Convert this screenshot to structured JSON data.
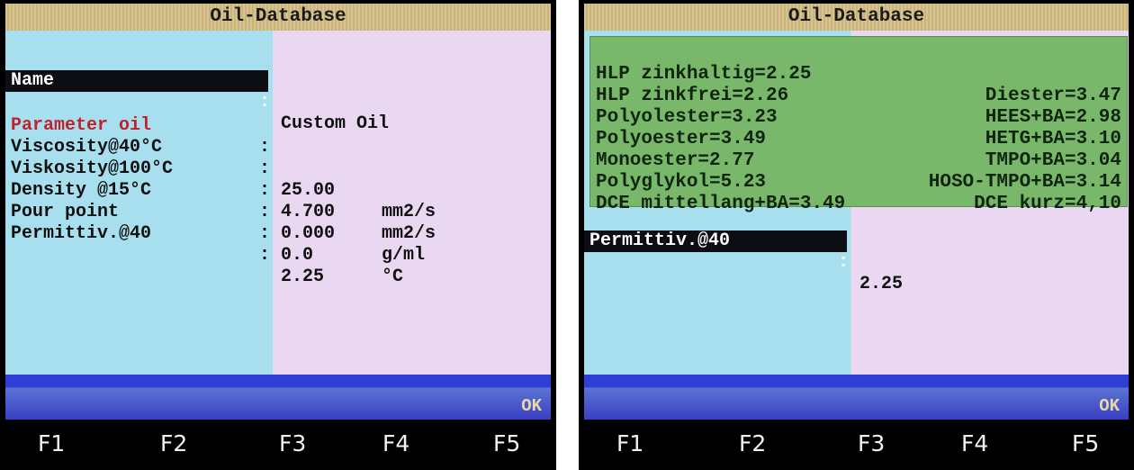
{
  "left": {
    "title": "Oil-Database",
    "name_label": "Name",
    "name_sep": ":",
    "name_value": "Custom Oil",
    "section": "Parameter oil",
    "section_sep": ":",
    "params": [
      {
        "label": "Viscosity@40°C",
        "sep": ":",
        "value": "25.00",
        "unit": "mm2/s"
      },
      {
        "label": "Viskosity@100°C",
        "sep": ":",
        "value": "4.700",
        "unit": "mm2/s"
      },
      {
        "label": "Density @15°C",
        "sep": ":",
        "value": "0.000",
        "unit": "g/ml"
      },
      {
        "label": "Pour point",
        "sep": ":",
        "value": "0.0",
        "unit": "°C"
      },
      {
        "label": "Permittiv.@40",
        "sep": ":",
        "value": "2.25",
        "unit": ""
      }
    ],
    "ok": "OK"
  },
  "right": {
    "title": "Oil-Database",
    "list": [
      {
        "left": "HLP zinkhaltig=2.25",
        "right": "Diester=3.47"
      },
      {
        "left": "HLP zinkfrei=2.26",
        "right": "HEES+BA=2.98"
      },
      {
        "left": "Polyolester=3.23",
        "right": "HETG+BA=3.10"
      },
      {
        "left": "Polyoester=3.49",
        "right": "TMPO+BA=3.04"
      },
      {
        "left": "Monoester=2.77",
        "right": "HOSO-TMPO+BA=3.14"
      },
      {
        "left": "Polyglykol=5.23",
        "right": "DCE kurz=4,10"
      },
      {
        "left": "DCE mittellang+BA=3.49",
        "right": ""
      }
    ],
    "selected_label": "Permittiv.@40",
    "selected_sep": ":",
    "selected_value": "2.25",
    "ok": "OK"
  },
  "fkeys": [
    "F1",
    "F2",
    "F3",
    "F4",
    "F5"
  ]
}
